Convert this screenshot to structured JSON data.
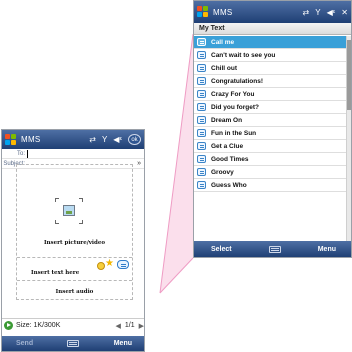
{
  "compose": {
    "title": "MMS",
    "ok_label": "ok",
    "to_label": "To:",
    "subject_label": "Subject:",
    "picture_label": "Insert picture/video",
    "text_label": "Insert text here",
    "audio_label": "Insert audio",
    "size_text": "Size: 1K/300K",
    "page_text": "1/1",
    "left_soft": "Send",
    "right_soft": "Menu"
  },
  "mytext": {
    "title": "MMS",
    "header": "My Text",
    "items": [
      "Call me",
      "Can't wait to see you",
      "Chill out",
      "Congratulations!",
      "Crazy For You",
      "Did you forget?",
      "Dream On",
      "Fun in the Sun",
      "Get a Clue",
      "Good Times",
      "Groovy",
      "Guess Who"
    ],
    "selected_index": 0,
    "left_soft": "Select",
    "right_soft": "Menu"
  },
  "colors": {
    "titlebar": "#2f5591",
    "selection": "#3aa0d8",
    "callout": "#f5b8d6"
  }
}
